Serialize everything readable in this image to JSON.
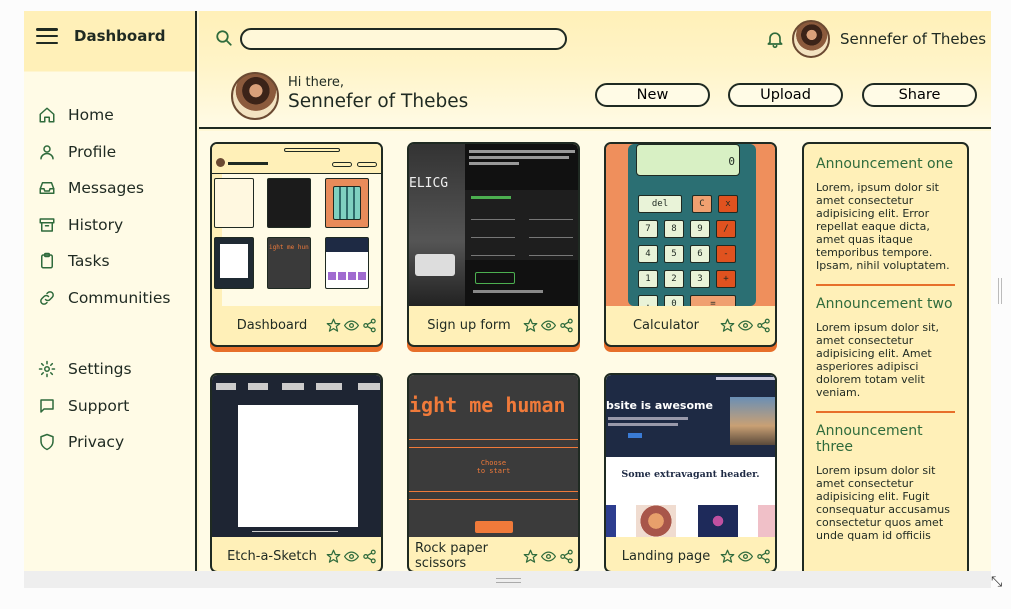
{
  "sidebar": {
    "title": "Dashboard",
    "items": [
      {
        "label": "Home",
        "icon": "home-icon"
      },
      {
        "label": "Profile",
        "icon": "user-icon"
      },
      {
        "label": "Messages",
        "icon": "inbox-icon"
      },
      {
        "label": "History",
        "icon": "archive-icon"
      },
      {
        "label": "Tasks",
        "icon": "clipboard-icon"
      },
      {
        "label": "Communities",
        "icon": "link-icon"
      }
    ],
    "secondary": [
      {
        "label": "Settings",
        "icon": "gear-icon"
      },
      {
        "label": "Support",
        "icon": "chat-icon"
      },
      {
        "label": "Privacy",
        "icon": "shield-icon"
      }
    ]
  },
  "header": {
    "search_placeholder": "",
    "username": "Sennefer of Thebes",
    "greeting": "Hi there,",
    "greeting_name": "Sennefer of Thebes",
    "buttons": {
      "new": "New",
      "upload": "Upload",
      "share": "Share"
    }
  },
  "projects": [
    {
      "title": "Dashboard"
    },
    {
      "title": "Sign up form"
    },
    {
      "title": "Calculator"
    },
    {
      "title": "Etch-a-Sketch"
    },
    {
      "title": "Rock paper scissors"
    },
    {
      "title": "Landing page"
    }
  ],
  "thumbs": {
    "calc_display": "0",
    "calc_keys": [
      "del",
      "C",
      "x",
      "7",
      "8",
      "9",
      "/",
      "4",
      "5",
      "6",
      "-",
      "1",
      "2",
      "3",
      "+",
      ".",
      "0",
      "="
    ],
    "rps_text": "ight me human",
    "rps_sub": "Choose\nto start",
    "landing_title": "bsite is awesome",
    "landing_header": "Some extravagant header.",
    "signup_brand": "ELICG"
  },
  "announcements": [
    {
      "title": "Announcement one",
      "body": "Lorem, ipsum dolor sit amet consectetur adipisicing elit. Error repellat eaque dicta, amet quas itaque temporibus tempore. Ipsam, nihil voluptatem."
    },
    {
      "title": "Announcement two",
      "body": "Lorem ipsum dolor sit, amet consectetur adipisicing elit. Amet asperiores adipisci dolorem totam velit veniam."
    },
    {
      "title": "Announcement three",
      "body": "Lorem ipsum dolor sit amet consectetur adipisicing elit. Fugit consequatur accusamus consectetur quos amet unde quam id officiis"
    }
  ],
  "colors": {
    "accent": "#e76f2a",
    "green": "#2f6b3c",
    "cream": "#fff0b8",
    "ink": "#1f2a22"
  }
}
